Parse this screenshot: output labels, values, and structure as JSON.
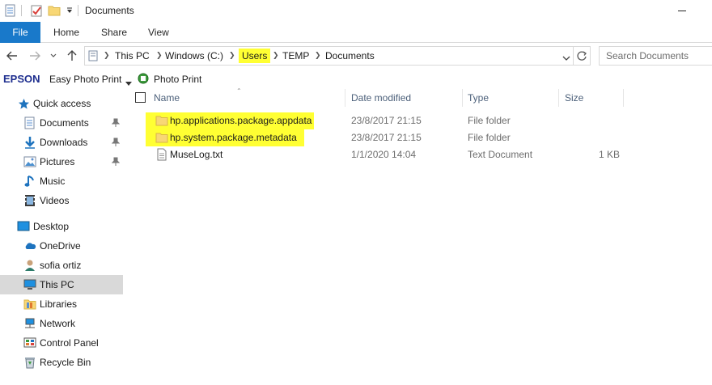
{
  "window": {
    "title": "Documents"
  },
  "ribbon": {
    "file_label": "File",
    "tabs": [
      "Home",
      "Share",
      "View"
    ]
  },
  "address": {
    "crumbs": [
      "This PC",
      "Windows (C:)",
      "Users",
      "TEMP",
      "Documents"
    ],
    "highlighted_crumb": "Users",
    "highlight_color": "#ffff33"
  },
  "search": {
    "placeholder": "Search Documents"
  },
  "epson_toolbar": {
    "brand": "EPSON",
    "easy_photo_print": "Easy Photo Print",
    "photo_print": "Photo Print"
  },
  "navigation": {
    "items": [
      {
        "label": "Quick access",
        "icon": "star-icon"
      },
      {
        "label": "Documents",
        "icon": "documents-icon",
        "pinned": true
      },
      {
        "label": "Downloads",
        "icon": "download-arrow-icon",
        "pinned": true
      },
      {
        "label": "Pictures",
        "icon": "pictures-icon",
        "pinned": true
      },
      {
        "label": "Music",
        "icon": "music-note-icon"
      },
      {
        "label": "Videos",
        "icon": "videos-icon"
      },
      {
        "label": "Desktop",
        "icon": "desktop-icon"
      },
      {
        "label": "OneDrive",
        "icon": "cloud-icon"
      },
      {
        "label": "sofia ortiz",
        "icon": "user-icon"
      },
      {
        "label": "This PC",
        "icon": "computer-icon",
        "selected": true
      },
      {
        "label": "Libraries",
        "icon": "libraries-icon"
      },
      {
        "label": "Network",
        "icon": "network-icon"
      },
      {
        "label": "Control Panel",
        "icon": "control-panel-icon"
      },
      {
        "label": "Recycle Bin",
        "icon": "recycle-bin-icon"
      }
    ]
  },
  "file_list": {
    "columns": [
      "Name",
      "Date modified",
      "Type",
      "Size"
    ],
    "rows": [
      {
        "name": "hp.applications.package.appdata",
        "date": "23/8/2017 21:15",
        "type": "File folder",
        "size": "",
        "icon": "folder-icon",
        "highlighted": true
      },
      {
        "name": "hp.system.package.metadata",
        "date": "23/8/2017 21:15",
        "type": "File folder",
        "size": "",
        "icon": "folder-icon",
        "highlighted": true
      },
      {
        "name": "MuseLog.txt",
        "date": "1/1/2020 14:04",
        "type": "Text Document",
        "size": "1 KB",
        "icon": "text-file-icon",
        "highlighted": false
      }
    ]
  },
  "colors": {
    "accent": "#1979ca",
    "highlight": "#ffff33",
    "folder": "#f8d775",
    "selected_nav": "#d9d9d9"
  }
}
